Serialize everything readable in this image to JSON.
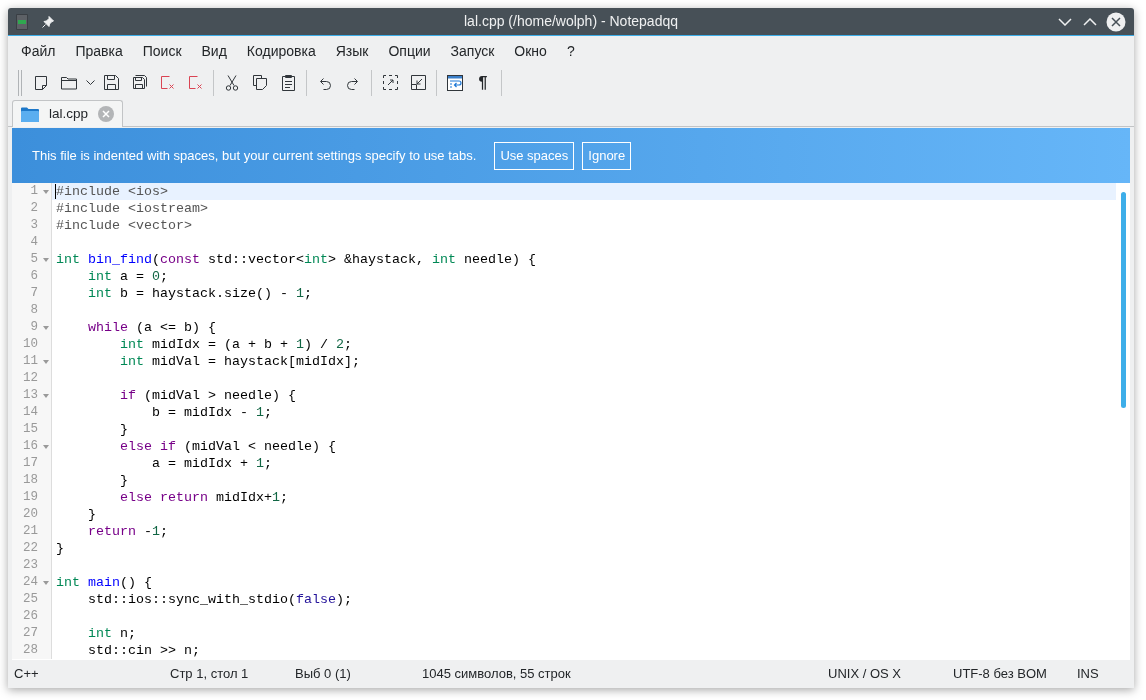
{
  "window": {
    "title": "lal.cpp (/home/wolph) - Notepadqq"
  },
  "menu": [
    "Файл",
    "Правка",
    "Поиск",
    "Вид",
    "Кодировка",
    "Язык",
    "Опции",
    "Запуск",
    "Окно",
    "?"
  ],
  "toolbar": {
    "pilcrow": "¶"
  },
  "tabs": [
    {
      "label": "lal.cpp",
      "selected": true
    }
  ],
  "info_bar": {
    "message": "This file is indented with spaces, but your current settings specify to use tabs.",
    "buttons": [
      "Use spaces",
      "Ignore"
    ]
  },
  "editor": {
    "lines": [
      {
        "number": "1",
        "foldable": true,
        "current": true,
        "tokens": [
          {
            "kind": "meta",
            "text": "#include <ios>"
          }
        ]
      },
      {
        "number": "2",
        "foldable": false,
        "current": false,
        "tokens": [
          {
            "kind": "meta",
            "text": "#include <iostream>"
          }
        ]
      },
      {
        "number": "3",
        "foldable": false,
        "current": false,
        "tokens": [
          {
            "kind": "meta",
            "text": "#include <vector>"
          }
        ]
      },
      {
        "number": "4",
        "foldable": false,
        "current": false
      },
      {
        "number": "5",
        "foldable": true,
        "current": false,
        "tokens": [
          {
            "kind": "type",
            "text": "int "
          },
          {
            "kind": "def",
            "text": "bin_find"
          },
          {
            "kind": "plain",
            "text": "("
          },
          {
            "kind": "keyword",
            "text": "const"
          },
          {
            "kind": "plain",
            "text": " std::vector<"
          },
          {
            "kind": "type",
            "text": "int"
          },
          {
            "kind": "plain",
            "text": "> &haystack, "
          },
          {
            "kind": "type",
            "text": "int"
          },
          {
            "kind": "plain",
            "text": " needle) {"
          }
        ]
      },
      {
        "number": "6",
        "foldable": false,
        "current": false,
        "tokens": [
          {
            "kind": "type",
            "text": "    int"
          },
          {
            "kind": "plain",
            "text": " a = "
          },
          {
            "kind": "number",
            "text": "0"
          },
          {
            "kind": "plain",
            "text": ";"
          }
        ]
      },
      {
        "number": "7",
        "foldable": false,
        "current": false,
        "tokens": [
          {
            "kind": "type",
            "text": "    int"
          },
          {
            "kind": "plain",
            "text": " b = haystack.size() - "
          },
          {
            "kind": "number",
            "text": "1"
          },
          {
            "kind": "plain",
            "text": ";"
          }
        ]
      },
      {
        "number": "8",
        "foldable": false,
        "current": false
      },
      {
        "number": "9",
        "foldable": true,
        "current": false,
        "tokens": [
          {
            "kind": "keyword",
            "text": "    while"
          },
          {
            "kind": "plain",
            "text": " (a <= b) {"
          }
        ]
      },
      {
        "number": "10",
        "foldable": false,
        "current": false,
        "tokens": [
          {
            "kind": "type",
            "text": "        int"
          },
          {
            "kind": "plain",
            "text": " midIdx = (a + b + "
          },
          {
            "kind": "number",
            "text": "1"
          },
          {
            "kind": "plain",
            "text": ") / "
          },
          {
            "kind": "number",
            "text": "2"
          },
          {
            "kind": "plain",
            "text": ";"
          }
        ]
      },
      {
        "number": "11",
        "foldable": true,
        "current": false,
        "tokens": [
          {
            "kind": "type",
            "text": "        int"
          },
          {
            "kind": "plain",
            "text": " midVal = haystack[midIdx];"
          }
        ]
      },
      {
        "number": "12",
        "foldable": false,
        "current": false
      },
      {
        "number": "13",
        "foldable": true,
        "current": false,
        "tokens": [
          {
            "kind": "keyword",
            "text": "        if"
          },
          {
            "kind": "plain",
            "text": " (midVal > needle) {"
          }
        ]
      },
      {
        "number": "14",
        "foldable": false,
        "current": false,
        "tokens": [
          {
            "kind": "plain",
            "text": "            b = midIdx - "
          },
          {
            "kind": "number",
            "text": "1"
          },
          {
            "kind": "plain",
            "text": ";"
          }
        ]
      },
      {
        "number": "15",
        "foldable": false,
        "current": false,
        "tokens": [
          {
            "kind": "plain",
            "text": "        }"
          }
        ]
      },
      {
        "number": "16",
        "foldable": true,
        "current": false,
        "tokens": [
          {
            "kind": "keyword",
            "text": "        else if"
          },
          {
            "kind": "plain",
            "text": " (midVal < needle) {"
          }
        ]
      },
      {
        "number": "17",
        "foldable": false,
        "current": false,
        "tokens": [
          {
            "kind": "plain",
            "text": "            a = midIdx + "
          },
          {
            "kind": "number",
            "text": "1"
          },
          {
            "kind": "plain",
            "text": ";"
          }
        ]
      },
      {
        "number": "18",
        "foldable": false,
        "current": false,
        "tokens": [
          {
            "kind": "plain",
            "text": "        }"
          }
        ]
      },
      {
        "number": "19",
        "foldable": false,
        "current": false,
        "tokens": [
          {
            "kind": "keyword",
            "text": "        else return"
          },
          {
            "kind": "plain",
            "text": " midIdx+"
          },
          {
            "kind": "number",
            "text": "1"
          },
          {
            "kind": "plain",
            "text": ";"
          }
        ]
      },
      {
        "number": "20",
        "foldable": false,
        "current": false,
        "tokens": [
          {
            "kind": "plain",
            "text": "    }"
          }
        ]
      },
      {
        "number": "21",
        "foldable": false,
        "current": false,
        "tokens": [
          {
            "kind": "keyword",
            "text": "    return"
          },
          {
            "kind": "plain",
            "text": " -"
          },
          {
            "kind": "number",
            "text": "1"
          },
          {
            "kind": "plain",
            "text": ";"
          }
        ]
      },
      {
        "number": "22",
        "foldable": false,
        "current": false,
        "tokens": [
          {
            "kind": "plain",
            "text": "}"
          }
        ]
      },
      {
        "number": "23",
        "foldable": false,
        "current": false
      },
      {
        "number": "24",
        "foldable": true,
        "current": false,
        "tokens": [
          {
            "kind": "type",
            "text": "int "
          },
          {
            "kind": "def",
            "text": "main"
          },
          {
            "kind": "plain",
            "text": "() {"
          }
        ]
      },
      {
        "number": "25",
        "foldable": false,
        "current": false,
        "tokens": [
          {
            "kind": "plain",
            "text": "    std::ios::sync_with_stdio("
          },
          {
            "kind": "atom",
            "text": "false"
          },
          {
            "kind": "plain",
            "text": ");"
          }
        ]
      },
      {
        "number": "26",
        "foldable": false,
        "current": false
      },
      {
        "number": "27",
        "foldable": false,
        "current": false,
        "tokens": [
          {
            "kind": "type",
            "text": "    int"
          },
          {
            "kind": "plain",
            "text": " n;"
          }
        ]
      },
      {
        "number": "28",
        "foldable": false,
        "current": false,
        "tokens": [
          {
            "kind": "plain",
            "text": "    std::cin >> n;"
          }
        ]
      }
    ]
  },
  "status_bar": {
    "language": "C++",
    "position": "Стр 1, стол 1",
    "selection": "Выб 0 (1)",
    "counts": "1045 символов, 55 строк",
    "line_endings": "UNIX / OS X",
    "encoding": "UTF-8 без BOM",
    "mode": "INS"
  }
}
